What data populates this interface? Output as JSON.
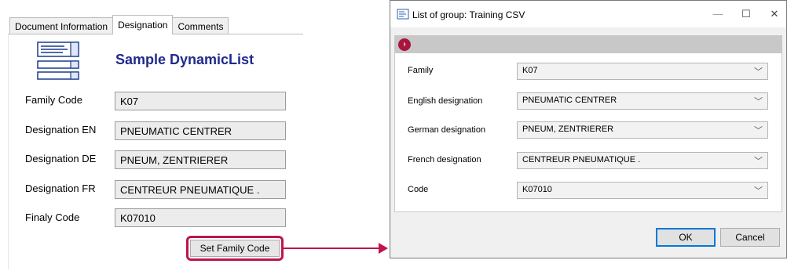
{
  "tabs": [
    {
      "label": "Document Information"
    },
    {
      "label": "Designation"
    },
    {
      "label": "Comments"
    }
  ],
  "panel": {
    "title": "Sample DynamicList",
    "rows": [
      {
        "label": "Family Code",
        "value": "K07"
      },
      {
        "label": "Designation EN",
        "value": "PNEUMATIC CENTRER"
      },
      {
        "label": "Designation DE",
        "value": "PNEUM, ZENTRIERER"
      },
      {
        "label": "Designation FR",
        "value": "CENTREUR PNEUMATIQUE ."
      },
      {
        "label": "Finaly Code",
        "value": "K07010"
      }
    ],
    "button_label": "Set Family Code",
    "highlight_color": "#c0144b"
  },
  "dialog": {
    "title": "List of group: Training CSV",
    "controls": {
      "minimize": "—",
      "maximize": "☐",
      "close": "✕"
    },
    "fields": [
      {
        "label": "Family",
        "value": "K07"
      },
      {
        "label": "English designation",
        "value": "PNEUMATIC CENTRER"
      },
      {
        "label": "German designation",
        "value": "PNEUM, ZENTRIERER"
      },
      {
        "label": "French designation",
        "value": "CENTREUR PNEUMATIQUE ."
      },
      {
        "label": "Code",
        "value": "K07010"
      }
    ],
    "ok_label": "OK",
    "cancel_label": "Cancel"
  }
}
